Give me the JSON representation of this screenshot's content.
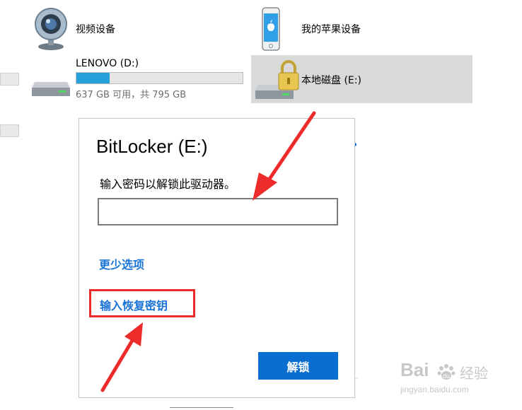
{
  "devices": {
    "webcam": {
      "name": "视频设备",
      "icon": "webcam-icon"
    },
    "apple": {
      "name": "我的苹果设备",
      "icon": "iphone-icon"
    },
    "lenovo": {
      "name": "LENOVO (D:)",
      "space": "637 GB 可用，共 795 GB",
      "used_fraction": 0.198,
      "icon": "hard-drive-icon"
    },
    "local": {
      "name": "本地磁盘 (E:)",
      "icon": "locked-drive-icon"
    }
  },
  "dialog": {
    "title": "BitLocker (E:)",
    "prompt": "输入密码以解锁此驱动器。",
    "password_value": "",
    "fewer_options": "更少选项",
    "recovery_key": "输入恢复密钥",
    "unlock": "解锁"
  },
  "watermark": {
    "logo_text": "Bai",
    "brand": "经验",
    "url": "jingyan.baidu.com"
  },
  "colors": {
    "accent": "#0a6ed1",
    "link": "#1a73d6",
    "annotation_red": "#ee2b2b",
    "progress": "#26a0da"
  }
}
